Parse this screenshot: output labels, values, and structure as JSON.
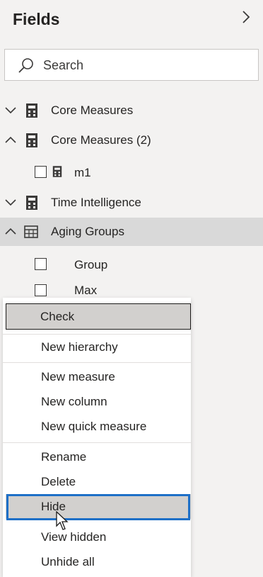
{
  "panel": {
    "title": "Fields",
    "collapse_icon": "chevron-right-icon",
    "search_placeholder": "Search"
  },
  "tree": [
    {
      "label": "Core Measures",
      "expanded": false,
      "icon": "calculator-icon"
    },
    {
      "label": "Core Measures (2)",
      "expanded": true,
      "icon": "calculator-icon"
    },
    {
      "label": "m1",
      "icon": "calculator-icon",
      "checked": false
    },
    {
      "label": "Time Intelligence",
      "expanded": false,
      "icon": "calculator-icon"
    },
    {
      "label": "Aging Groups",
      "expanded": true,
      "icon": "table-icon",
      "selected": true
    },
    {
      "label": "Group",
      "checked": false
    },
    {
      "label": "Max",
      "checked": false
    }
  ],
  "context_menu": {
    "items": [
      {
        "label": "Check"
      },
      {
        "label": "New hierarchy"
      },
      {
        "label": "New measure"
      },
      {
        "label": "New column"
      },
      {
        "label": "New quick measure"
      },
      {
        "label": "Rename"
      },
      {
        "label": "Delete"
      },
      {
        "label": "Hide"
      },
      {
        "label": "View hidden"
      },
      {
        "label": "Unhide all"
      }
    ],
    "focused_item": "Hide"
  },
  "colors": {
    "panel_bg": "#f3f2f1",
    "selected_row": "#d9d9d9",
    "focus_ring": "#1e6fc7",
    "menu_highlight": "#d2d0ce"
  }
}
